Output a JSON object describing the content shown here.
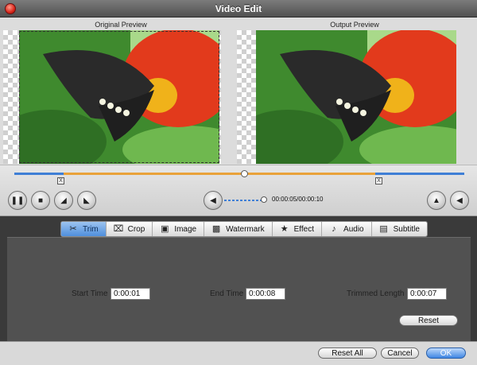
{
  "window": {
    "title": "Video Edit"
  },
  "preview": {
    "original_label": "Original Preview",
    "output_label": "Output Preview"
  },
  "player": {
    "timecode": "00:00:05/00:00:10",
    "trim_start_marker": "X",
    "trim_end_marker": "X"
  },
  "tabs": [
    {
      "label": "Trim",
      "icon": "scissors-icon",
      "active": true
    },
    {
      "label": "Crop",
      "icon": "crop-icon",
      "active": false
    },
    {
      "label": "Image",
      "icon": "image-icon",
      "active": false
    },
    {
      "label": "Watermark",
      "icon": "watermark-icon",
      "active": false
    },
    {
      "label": "Effect",
      "icon": "star-icon",
      "active": false
    },
    {
      "label": "Audio",
      "icon": "music-note-icon",
      "active": false
    },
    {
      "label": "Subtitle",
      "icon": "subtitle-icon",
      "active": false
    }
  ],
  "trim": {
    "start_label": "Start Time",
    "start_value": "0:00:01",
    "end_label": "End Time",
    "end_value": "0:00:08",
    "length_label": "Trimmed Length",
    "length_value": "0:00:07",
    "reset_label": "Reset"
  },
  "footer": {
    "reset_all_label": "Reset All",
    "cancel_label": "Cancel",
    "ok_label": "OK"
  },
  "colors": {
    "accent": "#3f7fd6",
    "selection": "#e9a23a",
    "active_tab": "#4f8fdc"
  }
}
